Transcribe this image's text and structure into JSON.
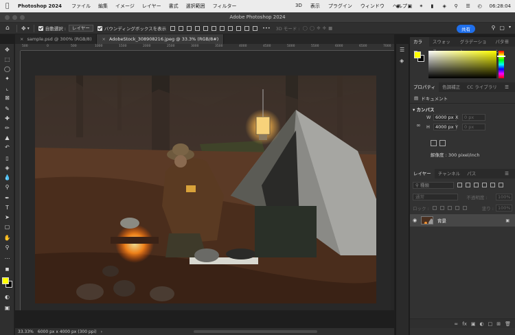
{
  "menubar": {
    "apple_icon": "apple-icon",
    "app_name": "Photoshop 2024",
    "items": [
      "ファイル",
      "編集",
      "イメージ",
      "レイヤー",
      "書式",
      "選択範囲",
      "フィルター"
    ],
    "right_items": [
      "3D",
      "表示",
      "プラグイン",
      "ウィンドウ",
      "ヘルプ"
    ],
    "clock": "06:28:04"
  },
  "titlebar": {
    "title": "Adobe Photoshop 2024"
  },
  "options": {
    "auto_select_label": "自動選択 :",
    "auto_select_value": "レイヤー",
    "bounding_box_label": "バウンディングボックスを表示",
    "mode3d_label": "3D モード :",
    "share_label": "共有"
  },
  "tabs": [
    {
      "label": "sample.psd @ 300% (RGB/8)",
      "active": false
    },
    {
      "label": "AdobeStock_308908216.jpeg @ 33.3% (RGB/8#)",
      "active": true
    }
  ],
  "ruler": {
    "top_ticks": [
      "500",
      "0",
      "500",
      "1000",
      "1500",
      "2000",
      "2500",
      "3000",
      "3500",
      "4000",
      "4500",
      "5000",
      "5500",
      "6000",
      "6500",
      "7000"
    ]
  },
  "status": {
    "zoom": "33.33%",
    "doc_info": "6000 px x 4000 px (300 ppi)"
  },
  "color_panel": {
    "tabs": [
      "カラー",
      "スウォッチ",
      "グラデーション",
      "パターン"
    ],
    "foreground": "#ffff00",
    "background": "#000000"
  },
  "properties_panel": {
    "tabs": [
      "プロパティ",
      "色調補正",
      "CC ライブラリ"
    ],
    "doc_label": "ドキュメント",
    "canvas_header": "カンバス",
    "width_label": "W",
    "width_value": "6000 px",
    "height_label": "H",
    "height_value": "4000 px",
    "x_label": "X",
    "x_value": "0 px",
    "y_label": "Y",
    "y_value": "0 px",
    "resolution": "解像度 : 300 pixel/inch"
  },
  "layers_panel": {
    "tabs": [
      "レイヤー",
      "チャンネル",
      "パス"
    ],
    "filter_label": "種類",
    "blend_mode": "通常",
    "opacity_label": "不透明度 :",
    "opacity_value": "100%",
    "lock_label": "ロック :",
    "fill_label": "塗り :",
    "fill_value": "100%",
    "layer_name": "背景"
  }
}
